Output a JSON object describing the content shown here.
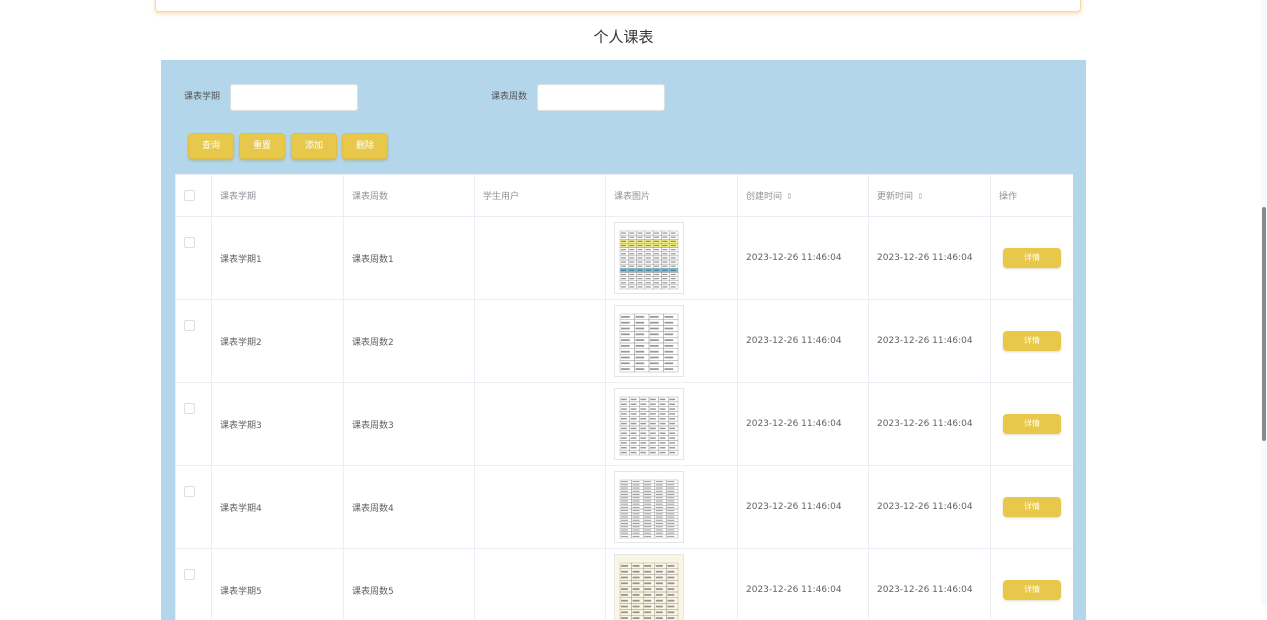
{
  "page": {
    "title": "个人课表"
  },
  "search": {
    "term_label": "课表学期",
    "term_value": "",
    "week_label": "课表周数",
    "week_value": ""
  },
  "buttons": {
    "query": "查询",
    "reset": "重置",
    "add": "添加",
    "delete": "删除"
  },
  "table": {
    "columns": [
      "课表学期",
      "课表周数",
      "学生用户",
      "课表图片",
      "创建时间",
      "更新时间",
      "操作"
    ],
    "rows": [
      {
        "term": "课表学期1",
        "week": "课表周数1",
        "student": "",
        "created": "2023-12-26 11:46:04",
        "updated": "2023-12-26 11:46:04",
        "action": "详情"
      },
      {
        "term": "课表学期2",
        "week": "课表周数2",
        "student": "",
        "created": "2023-12-26 11:46:04",
        "updated": "2023-12-26 11:46:04",
        "action": "详情"
      },
      {
        "term": "课表学期3",
        "week": "课表周数3",
        "student": "",
        "created": "2023-12-26 11:46:04",
        "updated": "2023-12-26 11:46:04",
        "action": "详情"
      },
      {
        "term": "课表学期4",
        "week": "课表周数4",
        "student": "",
        "created": "2023-12-26 11:46:04",
        "updated": "2023-12-26 11:46:04",
        "action": "详情"
      },
      {
        "term": "课表学期5",
        "week": "课表周数5",
        "student": "",
        "created": "2023-12-26 11:46:04",
        "updated": "2023-12-26 11:46:04",
        "action": "详情"
      }
    ]
  },
  "icons": {
    "sort": "sort-caret-icon",
    "checkbox": "checkbox-icon",
    "thumbnail": "schedule-image-icon"
  },
  "colors": {
    "panel": "#b3d6ea",
    "button": "#e8c84a",
    "button_text": "#ffffff"
  }
}
